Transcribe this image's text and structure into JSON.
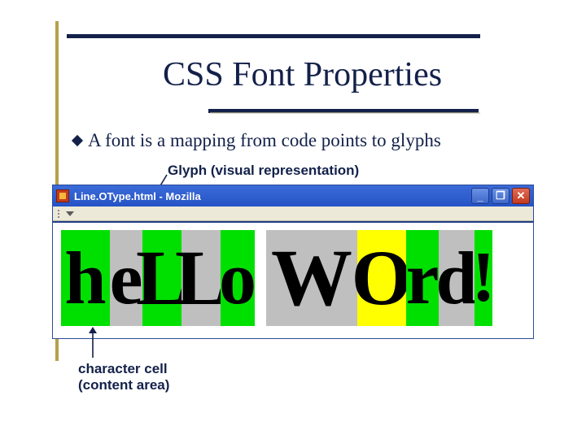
{
  "title": "CSS Font Properties",
  "bullet": "A font is a mapping from code points to glyphs",
  "glyph_label": "Glyph (visual representation)",
  "character_cell_label_l1": "character cell",
  "character_cell_label_l2": "(content area)",
  "window": {
    "title": "Line.OType.html - Mozilla",
    "min": "_",
    "max": "❐",
    "close": "✕"
  },
  "glyphs": {
    "h": "h",
    "e": "e",
    "L1": "L",
    "L2": "L",
    "o": "o",
    "W": "W",
    "O2": "O",
    "r": "r",
    "d": "d",
    "ex": "!"
  }
}
